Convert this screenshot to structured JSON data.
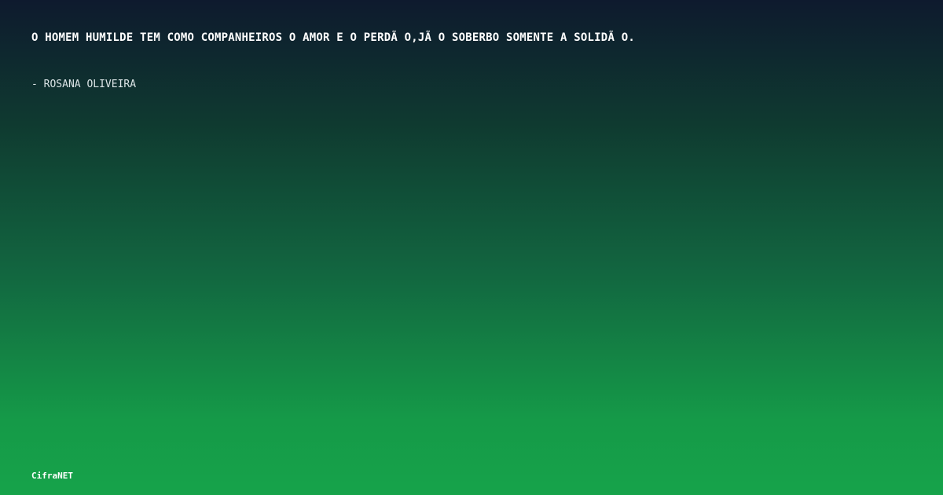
{
  "quote": {
    "text": "O HOMEM HUMILDE TEM COMO COMPANHEIROS O AMOR E O PERDÃ O,JÃ  O SOBERBO SOMENTE A SOLIDÃ O.",
    "author": "- ROSANA OLIVEIRA"
  },
  "brand": {
    "name": "CifraNET"
  },
  "colors": {
    "gradient_top": "#0e1a2e",
    "gradient_bottom": "#16a34a",
    "text": "#ffffff"
  }
}
